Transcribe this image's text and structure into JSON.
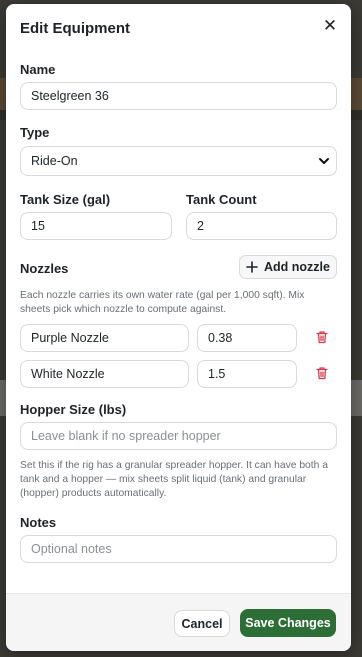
{
  "modal": {
    "title": "Edit Equipment",
    "close_glyph": "✕"
  },
  "fields": {
    "name": {
      "label": "Name",
      "value": "Steelgreen 36"
    },
    "type": {
      "label": "Type",
      "value": "Ride-On"
    },
    "tank_size": {
      "label": "Tank Size (gal)",
      "value": "15"
    },
    "tank_count": {
      "label": "Tank Count",
      "value": "2"
    },
    "hopper_size": {
      "label": "Hopper Size (lbs)",
      "placeholder": "Leave blank if no spreader hopper"
    },
    "notes": {
      "label": "Notes",
      "placeholder": "Optional notes"
    }
  },
  "nozzles": {
    "label": "Nozzles",
    "add_label": "Add nozzle",
    "help": "Each nozzle carries its own water rate (gal per 1,000 sqft). Mix sheets pick which nozzle to compute against.",
    "items": [
      {
        "name": "Purple Nozzle",
        "rate": "0.38"
      },
      {
        "name": "White Nozzle",
        "rate": "1.5"
      }
    ]
  },
  "hopper_help": "Set this if the rig has a granular spreader hopper. It can have both a tank and a hopper — mix sheets split liquid (tank) and granular (hopper) products automatically.",
  "footer": {
    "cancel_label": "Cancel",
    "save_label": "Save Changes"
  },
  "colors": {
    "accent": "#2c6e35",
    "danger": "#d83a4a"
  },
  "icons": {
    "close": "close-icon",
    "add": "plus-icon",
    "delete": "trash-icon",
    "select": "chevron-down-icon"
  }
}
